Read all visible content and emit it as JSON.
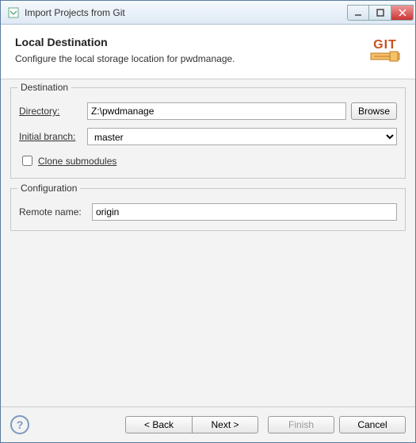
{
  "titlebar": {
    "title": "Import Projects from Git"
  },
  "banner": {
    "title": "Local Destination",
    "subtitle": "Configure the local storage location for pwdmanage.",
    "icon_text": "GIT"
  },
  "destination": {
    "group_label": "Destination",
    "directory_label": "Directory:",
    "directory_value": "Z:\\pwdmanage",
    "browse_label": "Browse",
    "initial_branch_label": "Initial branch:",
    "initial_branch_value": "master",
    "clone_submodules_label": "Clone submodules"
  },
  "configuration": {
    "group_label": "Configuration",
    "remote_name_label": "Remote name:",
    "remote_name_value": "origin"
  },
  "footer": {
    "help": "?",
    "back": "< Back",
    "next": "Next >",
    "finish": "Finish",
    "cancel": "Cancel"
  }
}
